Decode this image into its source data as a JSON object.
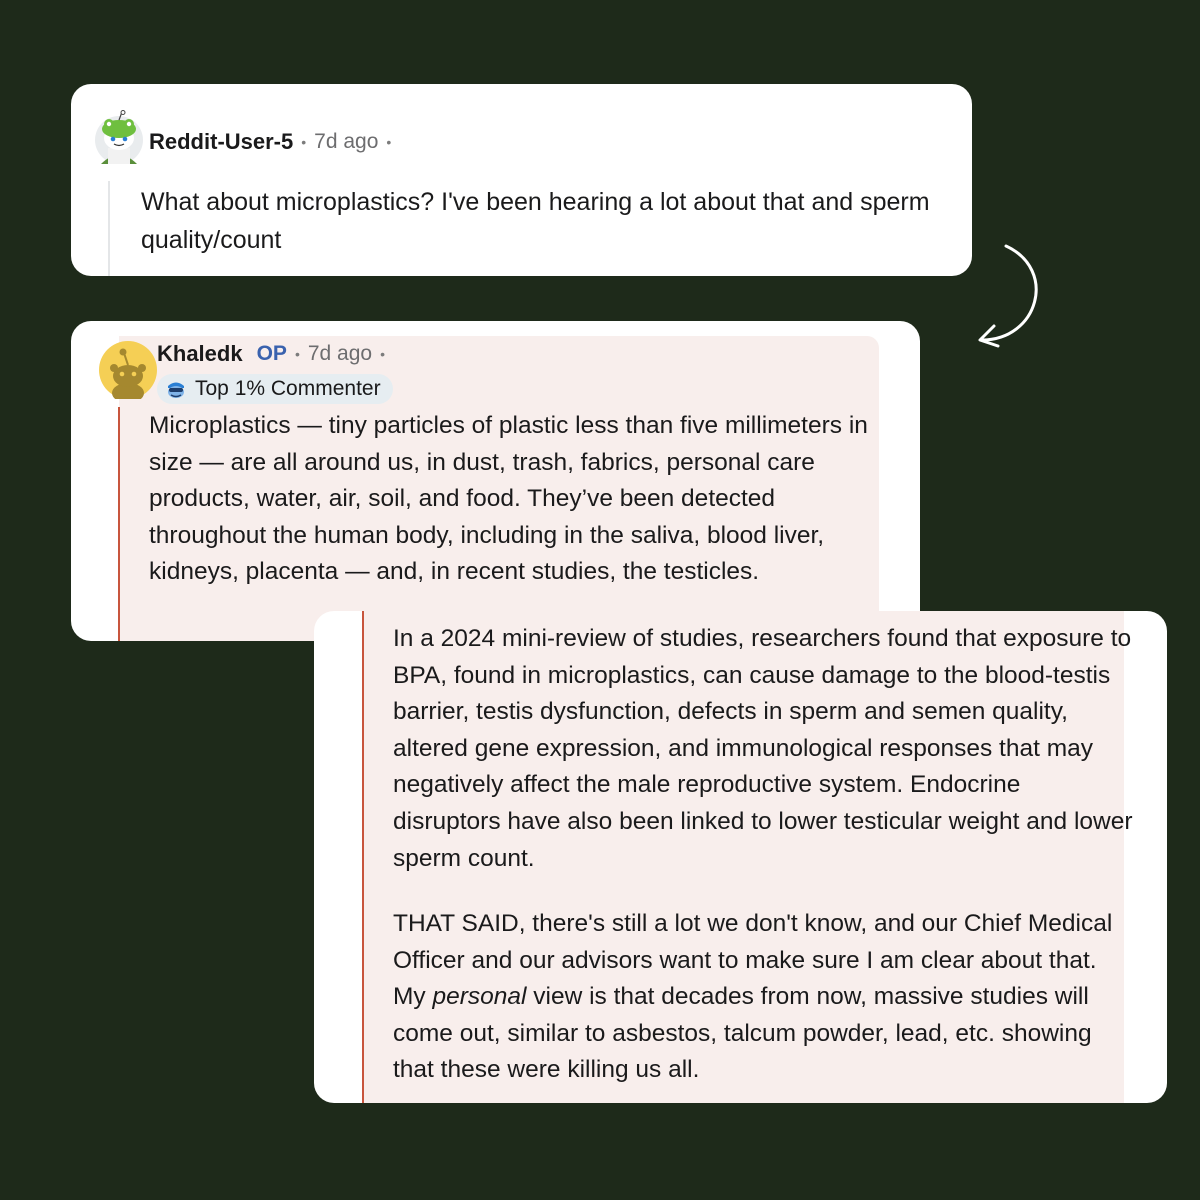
{
  "colors": {
    "background": "#1e2a1a",
    "card": "#ffffff",
    "highlight_tint": "#f8eeec",
    "thread_line_active": "#c8553d",
    "op_blue": "#3a62ae"
  },
  "comment_1": {
    "avatar_icon": "snoo-frog-avatar-icon",
    "username": "Reddit-User-5",
    "time": "7d ago",
    "text": "What about microplastics? I've been hearing a lot about that and sperm quality/count"
  },
  "arrow_icon": "curved-arrow-down-left-icon",
  "comment_2": {
    "avatar_icon": "snoo-default-avatar-icon",
    "username": "Khaledk",
    "op_label": "OP",
    "time": "7d ago",
    "badge_icon": "top-commenter-icon",
    "badge": "Top 1% Commenter",
    "text": "Microplastics — tiny particles of plastic less than five millimeters in size — are all around us, in dust, trash, fabrics, personal care products, water, air, soil, and food. They’ve been detected throughout the human body, including in the saliva, blood liver, kidneys, placenta — and, in recent studies, the testicles."
  },
  "comment_2_continued": {
    "paragraph_1": "In a 2024 mini-review of studies, researchers found that exposure to BPA, found in microplastics, can cause damage to the blood-testis barrier, testis dysfunction, defects in sperm and semen quality, altered gene expression, and immunological responses that may negatively affect the male reproductive system. Endocrine disruptors have also been linked to lower testicular weight and lower sperm count.",
    "paragraph_2_before": "THAT SAID, there's still a lot we don't know, and our Chief Medical Officer and our advisors want to make sure I am clear about that. My ",
    "paragraph_2_emphasis": "personal",
    "paragraph_2_after": " view is that decades from now, massive studies will come out, similar to asbestos, talcum powder, lead, etc. showing that these were killing us all."
  }
}
